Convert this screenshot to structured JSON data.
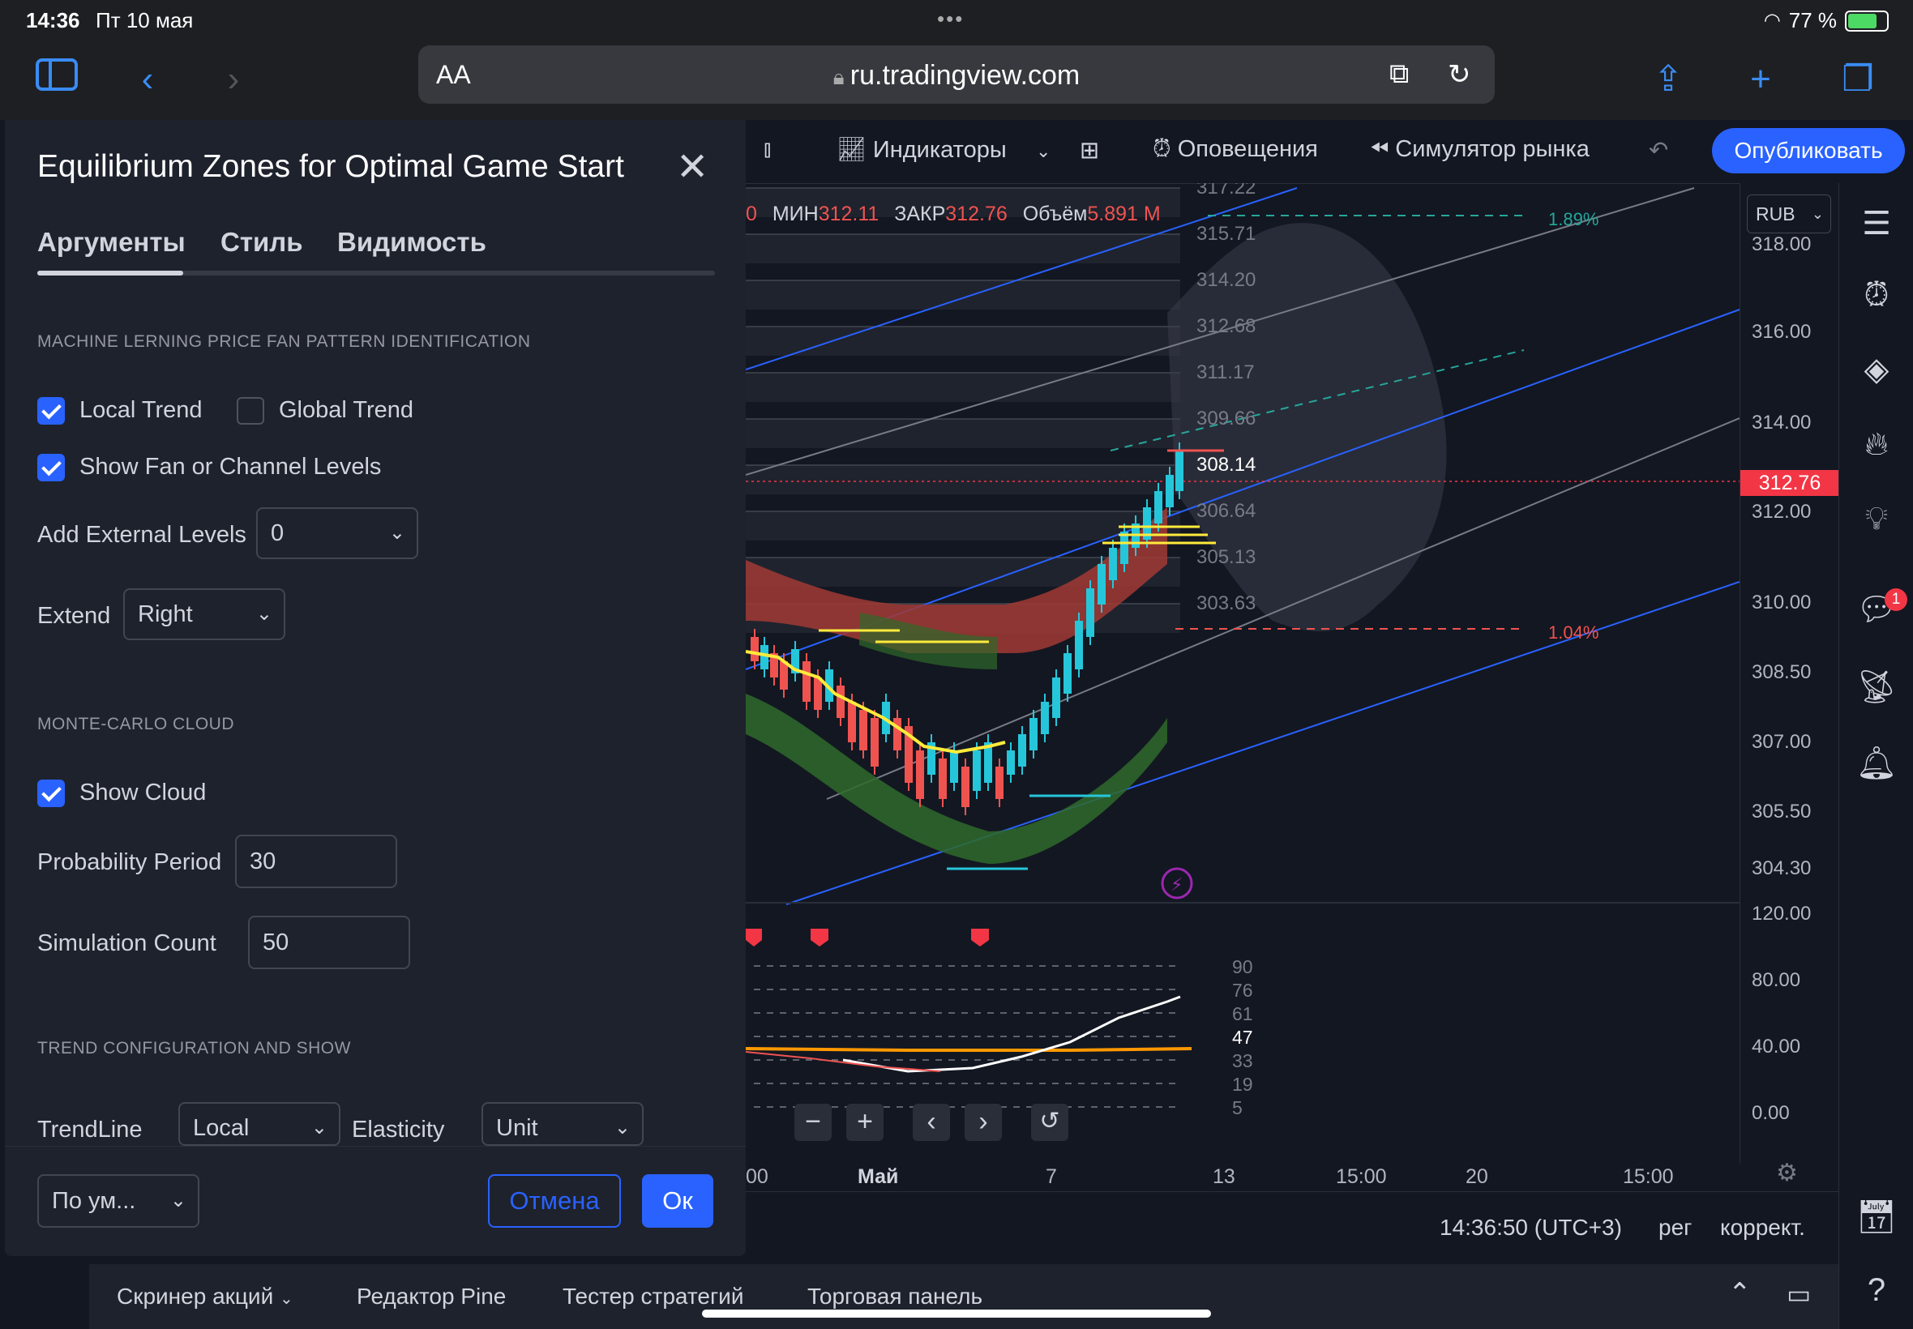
{
  "status_bar": {
    "time": "14:36",
    "date": "Пт 10 мая",
    "battery": "77 %",
    "battery_level": 0.77
  },
  "browser": {
    "aa_label": "AA",
    "url": "ru.tradingview.com"
  },
  "toolbar": {
    "indicators_label": "Индикаторы",
    "alerts_label": "Оповещения",
    "replay_label": "Симулятор рынка",
    "publish_label": "Опубликовать"
  },
  "dialog": {
    "title": "Equilibrium Zones for Optimal Game Start",
    "tabs": [
      "Аргументы",
      "Стиль",
      "Видимость"
    ],
    "section1": "MACHINE LERNING PRICE FAN PATTERN IDENTIFICATION",
    "local_trend_label": "Local Trend",
    "local_trend_checked": true,
    "global_trend_label": "Global Trend",
    "global_trend_checked": false,
    "show_fan_label": "Show Fan or Channel Levels",
    "show_fan_checked": true,
    "add_external_label": "Add External Levels",
    "add_external_value": "0",
    "extend_label": "Extend",
    "extend_value": "Right",
    "section2": "MONTE-CARLO CLOUD",
    "show_cloud_label": "Show Cloud",
    "show_cloud_checked": true,
    "prob_period_label": "Probability Period",
    "prob_period_value": "30",
    "sim_count_label": "Simulation Count",
    "sim_count_value": "50",
    "section3": "TREND CONFIGURATION AND SHOW",
    "trendline_label": "TrendLine",
    "trendline_value": "Local",
    "elasticity_label": "Elasticity",
    "elasticity_value": "Unit",
    "defaults_value": "По ум...",
    "cancel_label": "Отмена",
    "ok_label": "Ок"
  },
  "chart": {
    "ohlc_prefix": "0",
    "low_label": "МИН",
    "low_value": "312.11",
    "close_label": "ЗАКР",
    "close_value": "312.76",
    "volume_label": "Объём",
    "volume_value": "5.891 M",
    "currency": "RUB",
    "up_pct": "1.89%",
    "down_pct": "1.04%",
    "level_labels": [
      "317.22",
      "315.71",
      "314.20",
      "312.68",
      "311.17",
      "309.66",
      "308.14",
      "306.64",
      "305.13",
      "303.63"
    ],
    "price_axis": [
      "318.00",
      "316.00",
      "314.00",
      "312.00",
      "310.00",
      "308.50",
      "307.00",
      "305.50",
      "304.30"
    ],
    "last_price": "312.76",
    "osc_axis": [
      "120.00",
      "80.00",
      "40.00",
      "0.00"
    ],
    "osc_levels": [
      "90",
      "76",
      "61",
      "47",
      "33",
      "19",
      "5"
    ],
    "time_axis": [
      "00",
      "Май",
      "7",
      "13",
      "15:00",
      "20",
      "15:00"
    ],
    "clock": "14:36:50 (UTC+3)",
    "session": "рег",
    "adjust": "коррект."
  },
  "bottom_tabs": [
    "Скринер акций",
    "Редактор Pine",
    "Тестер стратегий",
    "Торговая панель"
  ],
  "notification_count": "1",
  "colors": {
    "accent": "#2962ff",
    "up": "#26c6da",
    "down": "#ef5350",
    "price_tag": "#f23645"
  }
}
